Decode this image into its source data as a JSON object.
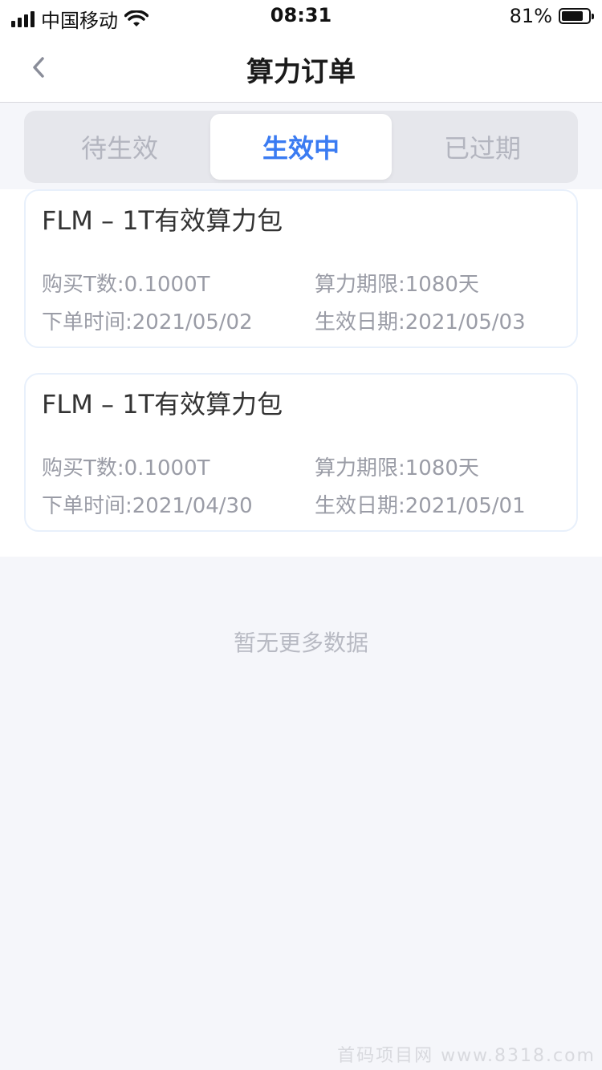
{
  "status_bar": {
    "carrier": "中国移动",
    "time": "08:31",
    "battery": "81%",
    "battery_level": 0.81
  },
  "nav": {
    "title": "算力订单"
  },
  "tabs": [
    {
      "label": "待生效",
      "active": false
    },
    {
      "label": "生效中",
      "active": true
    },
    {
      "label": "已过期",
      "active": false
    }
  ],
  "orders": [
    {
      "title": "FLM – 1T有效算力包",
      "purchase": "购买T数:0.1000T",
      "term": "算力期限:1080天",
      "order_time": "下单时间:2021/05/02",
      "effective_date": "生效日期:2021/05/03"
    },
    {
      "title": "FLM – 1T有效算力包",
      "purchase": "购买T数:0.1000T",
      "term": "算力期限:1080天",
      "order_time": "下单时间:2021/04/30",
      "effective_date": "生效日期:2021/05/01"
    }
  ],
  "empty_note": "暂无更多数据",
  "watermark": "首码项目网 www.8318.com",
  "colors": {
    "accent": "#3a7bf2",
    "muted_text": "#9a9ca6",
    "background": "#f5f6fa"
  }
}
